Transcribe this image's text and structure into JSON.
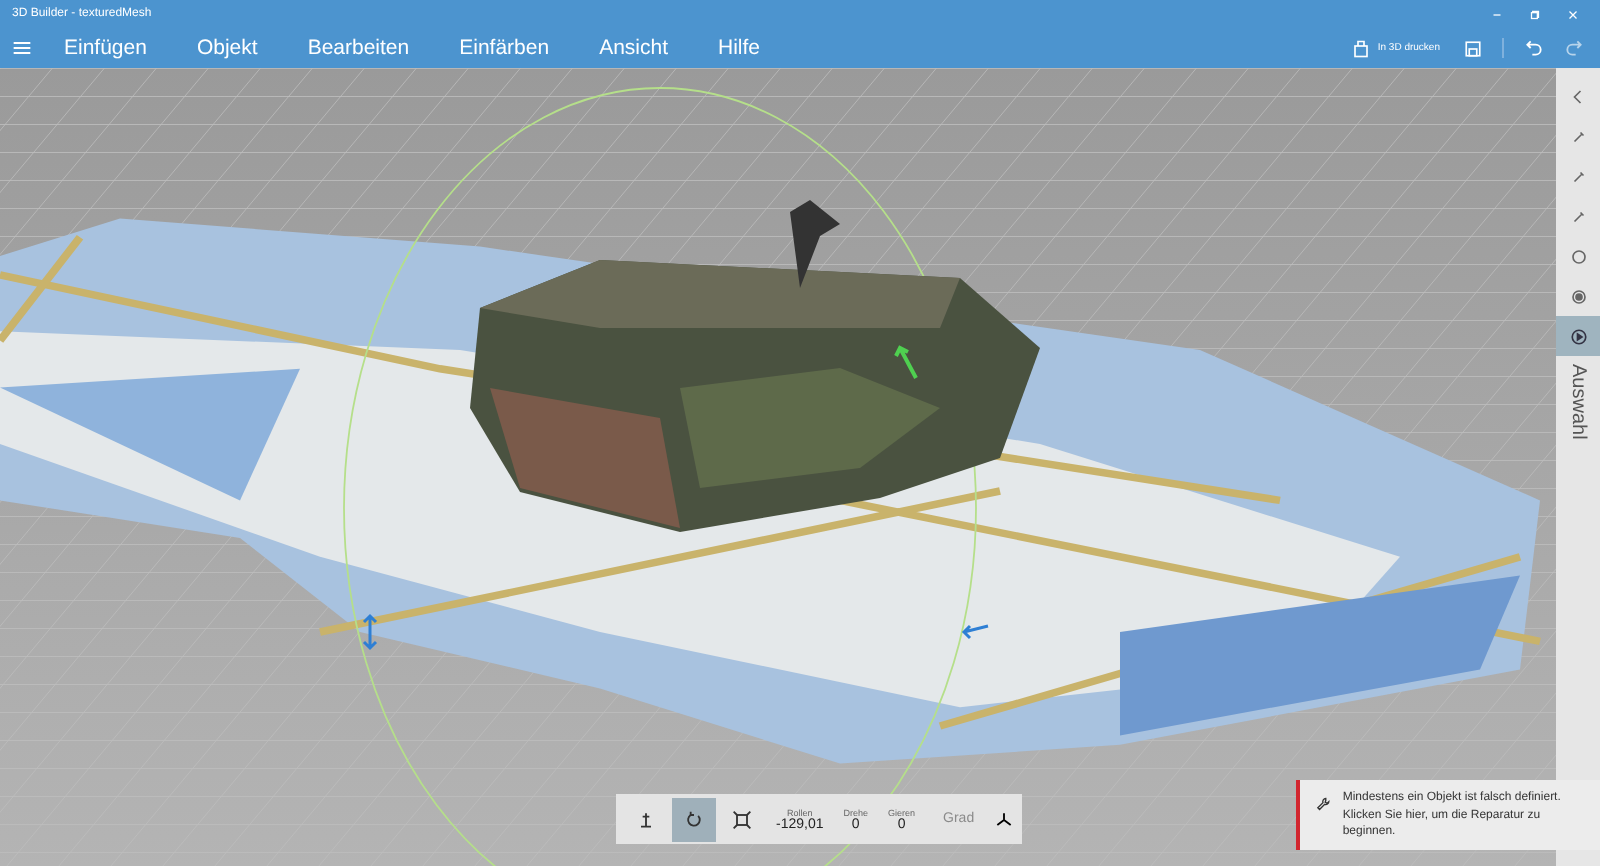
{
  "window": {
    "title": "3D Builder - texturedMesh"
  },
  "menu": [
    "Einfügen",
    "Objekt",
    "Bearbeiten",
    "Einfärben",
    "Ansicht",
    "Hilfe"
  ],
  "toolbar": {
    "print_label": "In 3D drucken"
  },
  "side_rail": {
    "label": "Auswahl",
    "items": [
      {
        "kind": "back",
        "selected": false
      },
      {
        "kind": "tool",
        "selected": false
      },
      {
        "kind": "tool",
        "selected": false
      },
      {
        "kind": "tool",
        "selected": false
      },
      {
        "kind": "circle",
        "selected": false
      },
      {
        "kind": "dot",
        "selected": false
      },
      {
        "kind": "select",
        "selected": true
      }
    ]
  },
  "transform_bar": {
    "modes": [
      {
        "kind": "move",
        "selected": false
      },
      {
        "kind": "rotate",
        "selected": true
      },
      {
        "kind": "scale",
        "selected": false
      }
    ],
    "fields": [
      {
        "label": "Rollen",
        "value": "-129,01"
      },
      {
        "label": "Drehe",
        "value": "0"
      },
      {
        "label": "Gieren",
        "value": "0"
      }
    ],
    "unit": "Grad"
  },
  "notification": {
    "text": "Mindestens ein Objekt ist falsch definiert. Klicken Sie hier, um die Reparatur zu beginnen."
  }
}
